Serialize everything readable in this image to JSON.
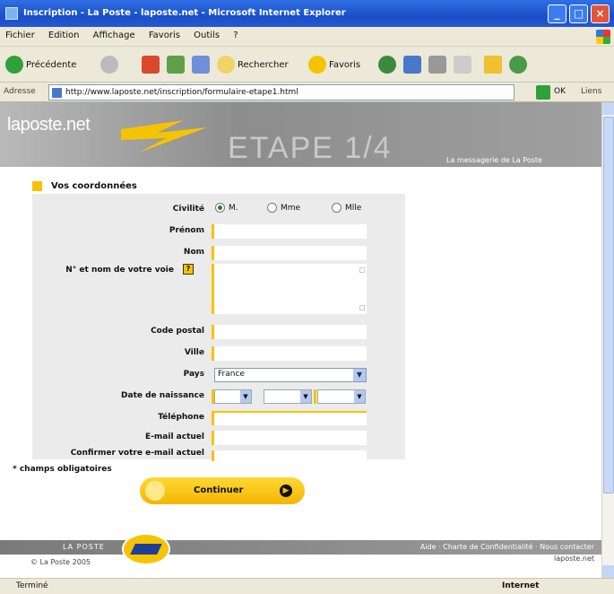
{
  "window": {
    "title": "Inscription - La Poste - laposte.net - Microsoft Internet Explorer",
    "controls": [
      "_",
      "□",
      "×"
    ]
  },
  "menu": [
    "Fichier",
    "Edition",
    "Affichage",
    "Favoris",
    "Outils",
    "?"
  ],
  "toolbar": {
    "back": "Précédente",
    "search": "Rechercher",
    "favorites": "Favoris"
  },
  "address": {
    "label": "Adresse",
    "url": "http://www.laposte.net/inscription/formulaire-etape1.html",
    "go": "OK",
    "links": "Liens"
  },
  "banner": {
    "logo": "laposte.net",
    "step": "ETAPE 1/4",
    "tagline": "La messagerie de La Poste"
  },
  "section_title": "Vos coordonnées",
  "form": {
    "civility": {
      "label": "Civilité",
      "options": [
        "M.",
        "Mme",
        "Mlle"
      ],
      "selected": "M."
    },
    "first_name": {
      "label": "Prénom"
    },
    "last_name": {
      "label": "Nom"
    },
    "address": {
      "label": "N° et nom de votre voie"
    },
    "postcode": {
      "label": "Code postal"
    },
    "city": {
      "label": "Ville"
    },
    "country": {
      "label": "Pays",
      "value": "France"
    },
    "birthdate": {
      "label": "Date de naissance"
    },
    "phone": {
      "label": "Téléphone"
    },
    "email": {
      "label": "E-mail actuel"
    },
    "email_confirm": {
      "label": "Confirmer votre e-mail actuel"
    },
    "help": "?"
  },
  "mandatory_note": "* champs obligatoires",
  "continue_label": "Continuer",
  "footer": {
    "group": "LA POSTE",
    "links": "Aide · Charte de Confidentialité · Nous contacter",
    "copyright": "© La Poste 2005",
    "right": "laposte.net"
  },
  "status": {
    "left": "Terminé",
    "right": "Internet"
  }
}
